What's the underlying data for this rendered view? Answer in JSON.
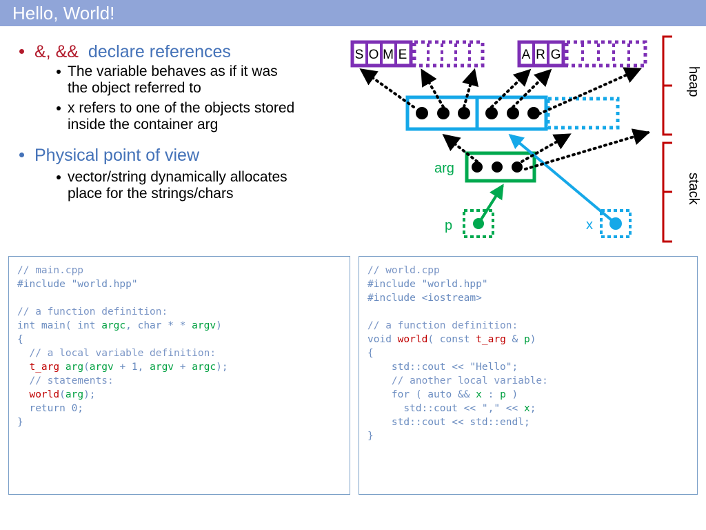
{
  "slide": {
    "title": "Hello, World!",
    "title_bar_color": "#90a5d8",
    "accent_blue": "#4472b8",
    "accent_red": "#b21a2b"
  },
  "bullets": [
    {
      "level": 1,
      "segments": [
        {
          "text": "&, && ",
          "color": "#b21a2b"
        },
        {
          "text": "declare references",
          "color": "#4472b8"
        }
      ],
      "plain": "&, && declare references"
    },
    {
      "level": 2,
      "text": "The variable behaves as if it was the object referred to"
    },
    {
      "level": 2,
      "text": "x refers to one of the objects stored inside the container arg"
    },
    {
      "level": 1,
      "plain": "Physical point of view",
      "color": "#4472b8"
    },
    {
      "level": 2,
      "text": "vector/string dynamically allocates place for the strings/chars"
    }
  ],
  "bullet_text": {
    "b1_red": "&, &&",
    "b1_blue": "declare references",
    "b2_line1": "The variable behaves as if it was",
    "b2_line2": "the object referred to",
    "b3_line1": "x refers to one of the objects stored",
    "b3_line2": "inside the container arg",
    "b4": "Physical point of view",
    "b5_line1": "vector/string dynamically allocates",
    "b5_line2": "place for the strings/chars"
  },
  "code_left": {
    "filename_comment": "// main.cpp",
    "lines": [
      [
        {
          "t": "// main.cpp",
          "c": "comment"
        }
      ],
      [
        {
          "t": "#include \"world.hpp\"",
          "c": "plain"
        }
      ],
      [
        {
          "t": "",
          "c": "plain"
        }
      ],
      [
        {
          "t": "// a function definition:",
          "c": "comment"
        }
      ],
      [
        {
          "t": "int main( int ",
          "c": "plain"
        },
        {
          "t": "argc",
          "c": "var"
        },
        {
          "t": ", char * * ",
          "c": "plain"
        },
        {
          "t": "argv",
          "c": "var"
        },
        {
          "t": ")",
          "c": "plain"
        }
      ],
      [
        {
          "t": "{",
          "c": "plain"
        }
      ],
      [
        {
          "t": "  // a local variable definition:",
          "c": "comment"
        }
      ],
      [
        {
          "t": "  ",
          "c": "plain"
        },
        {
          "t": "t_arg",
          "c": "type"
        },
        {
          "t": " ",
          "c": "plain"
        },
        {
          "t": "arg",
          "c": "var"
        },
        {
          "t": "(",
          "c": "plain"
        },
        {
          "t": "argv",
          "c": "var"
        },
        {
          "t": " + 1, ",
          "c": "plain"
        },
        {
          "t": "argv",
          "c": "var"
        },
        {
          "t": " + ",
          "c": "plain"
        },
        {
          "t": "argc",
          "c": "var"
        },
        {
          "t": ");",
          "c": "plain"
        }
      ],
      [
        {
          "t": "  // statements:",
          "c": "comment"
        }
      ],
      [
        {
          "t": "  ",
          "c": "plain"
        },
        {
          "t": "world",
          "c": "type"
        },
        {
          "t": "(",
          "c": "plain"
        },
        {
          "t": "arg",
          "c": "var"
        },
        {
          "t": ");",
          "c": "plain"
        }
      ],
      [
        {
          "t": "  return 0;",
          "c": "plain"
        }
      ],
      [
        {
          "t": "}",
          "c": "plain"
        }
      ]
    ]
  },
  "code_right": {
    "filename_comment": "// world.cpp",
    "lines": [
      [
        {
          "t": "// world.cpp",
          "c": "comment"
        }
      ],
      [
        {
          "t": "#include \"world.hpp\"",
          "c": "plain"
        }
      ],
      [
        {
          "t": "#include <iostream>",
          "c": "plain"
        }
      ],
      [
        {
          "t": "",
          "c": "plain"
        }
      ],
      [
        {
          "t": "// a function definition:",
          "c": "comment"
        }
      ],
      [
        {
          "t": "void ",
          "c": "plain"
        },
        {
          "t": "world",
          "c": "type"
        },
        {
          "t": "( const ",
          "c": "plain"
        },
        {
          "t": "t_arg",
          "c": "type"
        },
        {
          "t": " & ",
          "c": "plain"
        },
        {
          "t": "p",
          "c": "var"
        },
        {
          "t": ")",
          "c": "plain"
        }
      ],
      [
        {
          "t": "{",
          "c": "plain"
        }
      ],
      [
        {
          "t": "    std::cout << \"Hello\";",
          "c": "plain"
        }
      ],
      [
        {
          "t": "    // another local variable:",
          "c": "comment"
        }
      ],
      [
        {
          "t": "    for ( auto && ",
          "c": "plain"
        },
        {
          "t": "x",
          "c": "var"
        },
        {
          "t": " : ",
          "c": "plain"
        },
        {
          "t": "p",
          "c": "var"
        },
        {
          "t": " )",
          "c": "plain"
        }
      ],
      [
        {
          "t": "      std::cout << \",\" << ",
          "c": "plain"
        },
        {
          "t": "x",
          "c": "var"
        },
        {
          "t": ";",
          "c": "plain"
        }
      ],
      [
        {
          "t": "    std::cout << std::endl;",
          "c": "plain"
        }
      ],
      [
        {
          "t": "}",
          "c": "plain"
        }
      ]
    ]
  },
  "diagram": {
    "heap_label": "heap",
    "stack_label": "stack",
    "arg_label": "arg",
    "p_label": "p",
    "x_label": "x",
    "string_some": [
      "S",
      "O",
      "M",
      "E"
    ],
    "string_arg": [
      "A",
      "R",
      "G"
    ],
    "colors": {
      "purple": "#7d2fb5",
      "cyan": "#16a8e8",
      "green": "#00a94f",
      "red_bracket": "#c00000",
      "black": "#000000"
    },
    "vector_slot_counts": [
      3,
      3
    ],
    "arg_slot_count": 3
  }
}
